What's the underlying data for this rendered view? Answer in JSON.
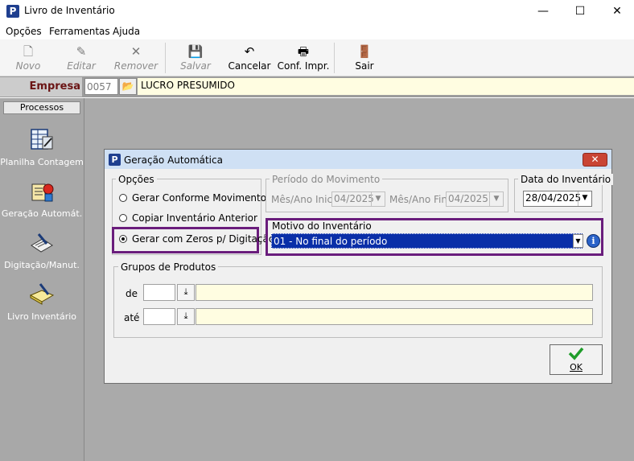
{
  "window": {
    "title": "Livro de Inventário",
    "minimize": "—",
    "maximize": "☐",
    "close": "✕"
  },
  "menu": [
    "Opções",
    "Ferramentas",
    "Ajuda"
  ],
  "toolbar": {
    "novo": "Novo",
    "editar": "Editar",
    "remover": "Remover",
    "salvar": "Salvar",
    "cancelar": "Cancelar",
    "conf_impr": "Conf. Impr.",
    "sair": "Sair"
  },
  "empresa": {
    "label": "Empresa",
    "code": "0057",
    "name": "LUCRO PRESUMIDO"
  },
  "sidebar": {
    "header": "Processos",
    "items": [
      "Planilha Contagem",
      "Geração Automát.",
      "Digitação/Manut.",
      "Livro Inventário"
    ]
  },
  "dialog": {
    "title": "Geração Automática",
    "opcoes": {
      "legend": "Opções",
      "options": [
        "Gerar Conforme Movimento",
        "Copiar Inventário Anterior",
        "Gerar com Zeros p/ Digitação"
      ],
      "selected_index": 2
    },
    "periodo": {
      "legend": "Período do Movimento",
      "inicial_label": "Mês/Ano Inicial",
      "inicial_value": "04/2025",
      "final_label": "Mês/Ano Final",
      "final_value": "04/2025"
    },
    "data_inventario": {
      "legend": "Data do Inventário",
      "value": "28/04/2025"
    },
    "motivo": {
      "legend": "Motivo do Inventário",
      "value": "01 - No final do período"
    },
    "grupos": {
      "legend": "Grupos de Produtos",
      "de_label": "de",
      "ate_label": "até"
    },
    "ok_label": "OK"
  },
  "colors": {
    "accent_highlight": "#6a1d7c",
    "selection": "#0a2fa8",
    "empresa_label": "#6a1414"
  }
}
